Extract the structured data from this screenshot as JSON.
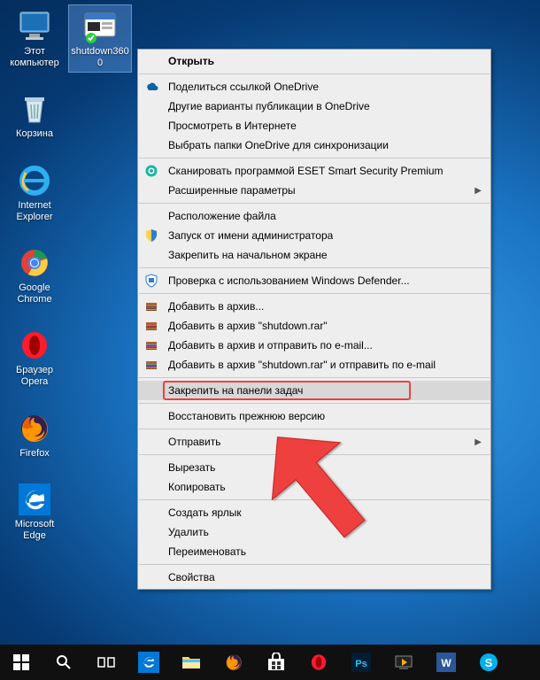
{
  "desktop_icons": [
    {
      "id": "this-pc",
      "label": "Этот компьютер"
    },
    {
      "id": "recycle-bin",
      "label": "Корзина"
    },
    {
      "id": "ie",
      "label": "Internet Explorer"
    },
    {
      "id": "chrome",
      "label": "Google Chrome"
    },
    {
      "id": "opera",
      "label": "Браузер Opera"
    },
    {
      "id": "firefox",
      "label": "Firefox"
    },
    {
      "id": "edge",
      "label": "Microsoft Edge"
    }
  ],
  "selected_icon": {
    "id": "shutdown3600",
    "label": "shutdown3600"
  },
  "context_menu": {
    "items": [
      {
        "label": "Открыть",
        "bold": true,
        "sep_after": true
      },
      {
        "label": "Поделиться ссылкой OneDrive",
        "icon": "onedrive"
      },
      {
        "label": "Другие варианты публикации в OneDrive"
      },
      {
        "label": "Просмотреть в Интернете"
      },
      {
        "label": "Выбрать папки OneDrive для синхронизации",
        "sep_after": true
      },
      {
        "label": "Сканировать программой ESET Smart Security Premium",
        "icon": "eset"
      },
      {
        "label": "Расширенные параметры",
        "submenu": true,
        "sep_after": true
      },
      {
        "label": "Расположение файла"
      },
      {
        "label": "Запуск от имени администратора",
        "icon": "shield"
      },
      {
        "label": "Закрепить на начальном экране",
        "sep_after": true
      },
      {
        "label": "Проверка с использованием Windows Defender...",
        "icon": "defender",
        "sep_after": true
      },
      {
        "label": "Добавить в архив...",
        "icon": "winrar"
      },
      {
        "label": "Добавить в архив \"shutdown.rar\"",
        "icon": "winrar"
      },
      {
        "label": "Добавить в архив и отправить по e-mail...",
        "icon": "winrar"
      },
      {
        "label": "Добавить в архив \"shutdown.rar\" и отправить по e-mail",
        "icon": "winrar",
        "sep_after": true
      },
      {
        "label": "Закрепить на панели задач",
        "hover": true,
        "redbox": true,
        "sep_after": true
      },
      {
        "label": "Восстановить прежнюю версию",
        "sep_after": true
      },
      {
        "label": "Отправить",
        "submenu": true,
        "sep_after": true
      },
      {
        "label": "Вырезать"
      },
      {
        "label": "Копировать",
        "sep_after": true
      },
      {
        "label": "Создать ярлык"
      },
      {
        "label": "Удалить"
      },
      {
        "label": "Переименовать",
        "sep_after": true
      },
      {
        "label": "Свойства"
      }
    ]
  },
  "taskbar": [
    {
      "id": "start",
      "name": "start-button"
    },
    {
      "id": "search",
      "name": "search-button"
    },
    {
      "id": "taskview",
      "name": "task-view-button"
    },
    {
      "id": "edge",
      "name": "edge-app"
    },
    {
      "id": "explorer",
      "name": "file-explorer-app"
    },
    {
      "id": "firefox",
      "name": "firefox-app"
    },
    {
      "id": "store",
      "name": "store-app"
    },
    {
      "id": "opera",
      "name": "opera-app"
    },
    {
      "id": "photoshop",
      "name": "photoshop-app"
    },
    {
      "id": "mpc",
      "name": "media-player-app"
    },
    {
      "id": "word",
      "name": "word-app"
    },
    {
      "id": "skype",
      "name": "skype-app"
    }
  ],
  "colors": {
    "accent": "#0078d7",
    "arrow": "#ef3f3f"
  }
}
